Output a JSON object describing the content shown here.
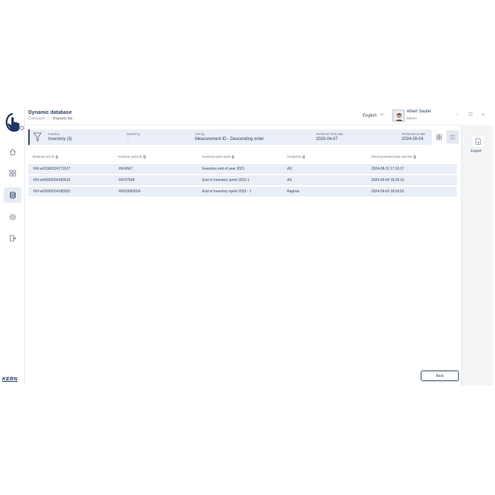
{
  "header": {
    "title": "Dynamic database",
    "breadcrumb": [
      "Database",
      "Reports list"
    ],
    "language": "English",
    "user": {
      "name": "Albert Sauter",
      "role": "Admin"
    }
  },
  "filters": {
    "function": {
      "label": "Function",
      "value": "Inventory (3)"
    },
    "search": {
      "label": "Search by",
      "value": "-"
    },
    "sort": {
      "label": "Sort by",
      "value": "Measurement ID - Descending order"
    },
    "from": {
      "label": "Performed from date",
      "value": "2020-04-07"
    },
    "to": {
      "label": "Performed to date",
      "value": "2024-09-04"
    }
  },
  "table": {
    "columns": [
      "Measurement ID",
      "Inventory sprint ID",
      "Inventory sprint name",
      "Created by",
      "Result generated date and time"
    ],
    "rows": [
      [
        "INV-w31082024171617",
        "INV4567",
        "Inventory end of year 2023",
        "AS",
        "2024-08-31 17:16:17"
      ],
      [
        "INV-w04092024183510",
        "INV37548",
        "End of inventory sprint 2022-1",
        "AS",
        "2024-09-04 18:35:10"
      ],
      [
        "INV-w03092024185952",
        "INV03092024",
        "End of inventory sprint 2023 - 1",
        "Raghav",
        "2024-09-03 18:59:52"
      ]
    ]
  },
  "right_panel": {
    "export_label": "Export"
  },
  "footer": {
    "back_label": "Back"
  },
  "brand": {
    "logo_text": "KERN",
    "accent": "#2a3b63",
    "row_bg": "#eaeef6"
  },
  "icons": [
    "home-icon",
    "apps-icon",
    "database-icon",
    "settings-icon",
    "logout-icon",
    "filter-icon",
    "grid-view-icon",
    "list-view-icon",
    "export-icon",
    "chevron-down-icon"
  ]
}
